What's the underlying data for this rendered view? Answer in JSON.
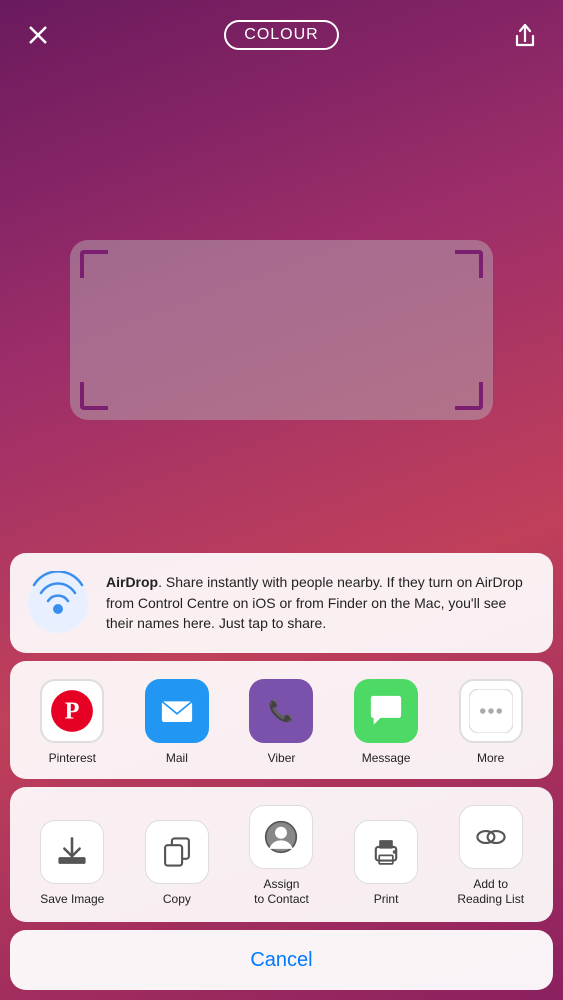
{
  "header": {
    "title": "COLOUR",
    "close_label": "×",
    "share_label": "share"
  },
  "airdrop": {
    "title": "AirDrop",
    "description": ". Share instantly with people nearby. If they turn on AirDrop from Control Centre on iOS or from Finder on the Mac, you'll see their names here. Just tap to share."
  },
  "apps": [
    {
      "id": "pinterest",
      "label": "Pinterest"
    },
    {
      "id": "mail",
      "label": "Mail"
    },
    {
      "id": "viber",
      "label": "Viber"
    },
    {
      "id": "message",
      "label": "Message"
    },
    {
      "id": "more",
      "label": "More"
    }
  ],
  "actions": [
    {
      "id": "save-image",
      "label": "Save Image"
    },
    {
      "id": "copy",
      "label": "Copy"
    },
    {
      "id": "assign-to-contact",
      "label": "Assign\nto Contact"
    },
    {
      "id": "print",
      "label": "Print"
    },
    {
      "id": "add-to-reading",
      "label": "Add to\nReading List"
    }
  ],
  "cancel": {
    "label": "Cancel"
  }
}
